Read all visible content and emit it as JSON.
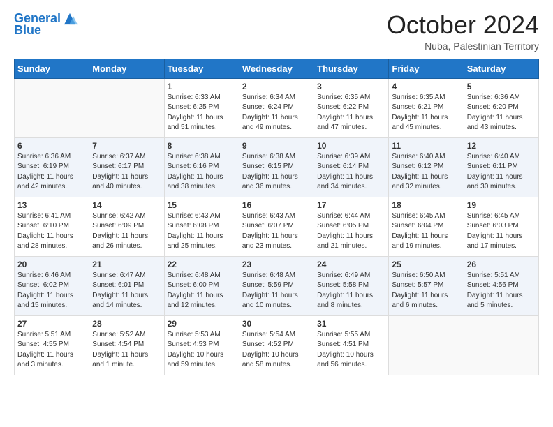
{
  "logo": {
    "line1": "General",
    "line2": "Blue"
  },
  "title": "October 2024",
  "subtitle": "Nuba, Palestinian Territory",
  "weekdays": [
    "Sunday",
    "Monday",
    "Tuesday",
    "Wednesday",
    "Thursday",
    "Friday",
    "Saturday"
  ],
  "weeks": [
    [
      {
        "day": "",
        "info": ""
      },
      {
        "day": "",
        "info": ""
      },
      {
        "day": "1",
        "info": "Sunrise: 6:33 AM\nSunset: 6:25 PM\nDaylight: 11 hours and 51 minutes."
      },
      {
        "day": "2",
        "info": "Sunrise: 6:34 AM\nSunset: 6:24 PM\nDaylight: 11 hours and 49 minutes."
      },
      {
        "day": "3",
        "info": "Sunrise: 6:35 AM\nSunset: 6:22 PM\nDaylight: 11 hours and 47 minutes."
      },
      {
        "day": "4",
        "info": "Sunrise: 6:35 AM\nSunset: 6:21 PM\nDaylight: 11 hours and 45 minutes."
      },
      {
        "day": "5",
        "info": "Sunrise: 6:36 AM\nSunset: 6:20 PM\nDaylight: 11 hours and 43 minutes."
      }
    ],
    [
      {
        "day": "6",
        "info": "Sunrise: 6:36 AM\nSunset: 6:19 PM\nDaylight: 11 hours and 42 minutes."
      },
      {
        "day": "7",
        "info": "Sunrise: 6:37 AM\nSunset: 6:17 PM\nDaylight: 11 hours and 40 minutes."
      },
      {
        "day": "8",
        "info": "Sunrise: 6:38 AM\nSunset: 6:16 PM\nDaylight: 11 hours and 38 minutes."
      },
      {
        "day": "9",
        "info": "Sunrise: 6:38 AM\nSunset: 6:15 PM\nDaylight: 11 hours and 36 minutes."
      },
      {
        "day": "10",
        "info": "Sunrise: 6:39 AM\nSunset: 6:14 PM\nDaylight: 11 hours and 34 minutes."
      },
      {
        "day": "11",
        "info": "Sunrise: 6:40 AM\nSunset: 6:12 PM\nDaylight: 11 hours and 32 minutes."
      },
      {
        "day": "12",
        "info": "Sunrise: 6:40 AM\nSunset: 6:11 PM\nDaylight: 11 hours and 30 minutes."
      }
    ],
    [
      {
        "day": "13",
        "info": "Sunrise: 6:41 AM\nSunset: 6:10 PM\nDaylight: 11 hours and 28 minutes."
      },
      {
        "day": "14",
        "info": "Sunrise: 6:42 AM\nSunset: 6:09 PM\nDaylight: 11 hours and 26 minutes."
      },
      {
        "day": "15",
        "info": "Sunrise: 6:43 AM\nSunset: 6:08 PM\nDaylight: 11 hours and 25 minutes."
      },
      {
        "day": "16",
        "info": "Sunrise: 6:43 AM\nSunset: 6:07 PM\nDaylight: 11 hours and 23 minutes."
      },
      {
        "day": "17",
        "info": "Sunrise: 6:44 AM\nSunset: 6:05 PM\nDaylight: 11 hours and 21 minutes."
      },
      {
        "day": "18",
        "info": "Sunrise: 6:45 AM\nSunset: 6:04 PM\nDaylight: 11 hours and 19 minutes."
      },
      {
        "day": "19",
        "info": "Sunrise: 6:45 AM\nSunset: 6:03 PM\nDaylight: 11 hours and 17 minutes."
      }
    ],
    [
      {
        "day": "20",
        "info": "Sunrise: 6:46 AM\nSunset: 6:02 PM\nDaylight: 11 hours and 15 minutes."
      },
      {
        "day": "21",
        "info": "Sunrise: 6:47 AM\nSunset: 6:01 PM\nDaylight: 11 hours and 14 minutes."
      },
      {
        "day": "22",
        "info": "Sunrise: 6:48 AM\nSunset: 6:00 PM\nDaylight: 11 hours and 12 minutes."
      },
      {
        "day": "23",
        "info": "Sunrise: 6:48 AM\nSunset: 5:59 PM\nDaylight: 11 hours and 10 minutes."
      },
      {
        "day": "24",
        "info": "Sunrise: 6:49 AM\nSunset: 5:58 PM\nDaylight: 11 hours and 8 minutes."
      },
      {
        "day": "25",
        "info": "Sunrise: 6:50 AM\nSunset: 5:57 PM\nDaylight: 11 hours and 6 minutes."
      },
      {
        "day": "26",
        "info": "Sunrise: 5:51 AM\nSunset: 4:56 PM\nDaylight: 11 hours and 5 minutes."
      }
    ],
    [
      {
        "day": "27",
        "info": "Sunrise: 5:51 AM\nSunset: 4:55 PM\nDaylight: 11 hours and 3 minutes."
      },
      {
        "day": "28",
        "info": "Sunrise: 5:52 AM\nSunset: 4:54 PM\nDaylight: 11 hours and 1 minute."
      },
      {
        "day": "29",
        "info": "Sunrise: 5:53 AM\nSunset: 4:53 PM\nDaylight: 10 hours and 59 minutes."
      },
      {
        "day": "30",
        "info": "Sunrise: 5:54 AM\nSunset: 4:52 PM\nDaylight: 10 hours and 58 minutes."
      },
      {
        "day": "31",
        "info": "Sunrise: 5:55 AM\nSunset: 4:51 PM\nDaylight: 10 hours and 56 minutes."
      },
      {
        "day": "",
        "info": ""
      },
      {
        "day": "",
        "info": ""
      }
    ]
  ],
  "colors": {
    "header_bg": "#2176c7",
    "row_odd": "#ffffff",
    "row_even": "#eef2f8"
  }
}
